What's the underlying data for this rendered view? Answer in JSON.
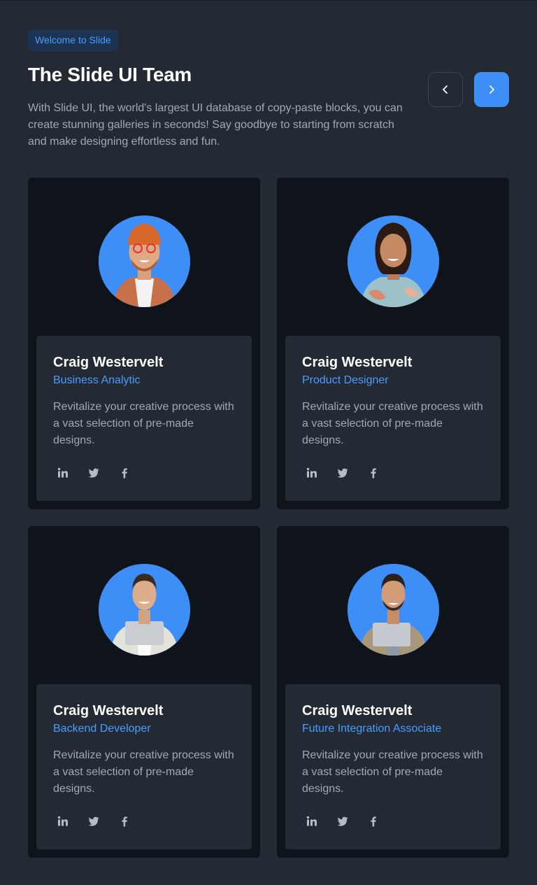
{
  "header": {
    "badge": "Welcome to Slide",
    "title": "The Slide UI Team",
    "subtitle": "With Slide UI, the world's largest UI database of copy-paste blocks, you can create stunning galleries in seconds! Say goodbye to starting from scratch and make designing effortless and fun."
  },
  "nav": {
    "prev_icon": "chevron-left-icon",
    "next_icon": "chevron-right-icon",
    "accent_color": "#3e8ef7"
  },
  "team": [
    {
      "name": "Craig Westervelt",
      "role": "Business Analytic",
      "bio": "Revitalize your creative process with a vast selection of pre-made designs."
    },
    {
      "name": "Craig Westervelt",
      "role": "Product Designer",
      "bio": "Revitalize your creative process with a vast selection of pre-made designs."
    },
    {
      "name": "Craig Westervelt",
      "role": "Backend Developer",
      "bio": "Revitalize your creative process with a vast selection of pre-made designs."
    },
    {
      "name": "Craig Westervelt",
      "role": "Future Integration Associate",
      "bio": "Revitalize your creative process with a vast selection of pre-made designs."
    }
  ],
  "social_icons": [
    "linkedin-icon",
    "twitter-icon",
    "facebook-icon"
  ],
  "colors": {
    "background": "#242a33",
    "card": "#0f131a",
    "accent": "#4b9cff",
    "avatar_bg": "#3e8ef7"
  }
}
